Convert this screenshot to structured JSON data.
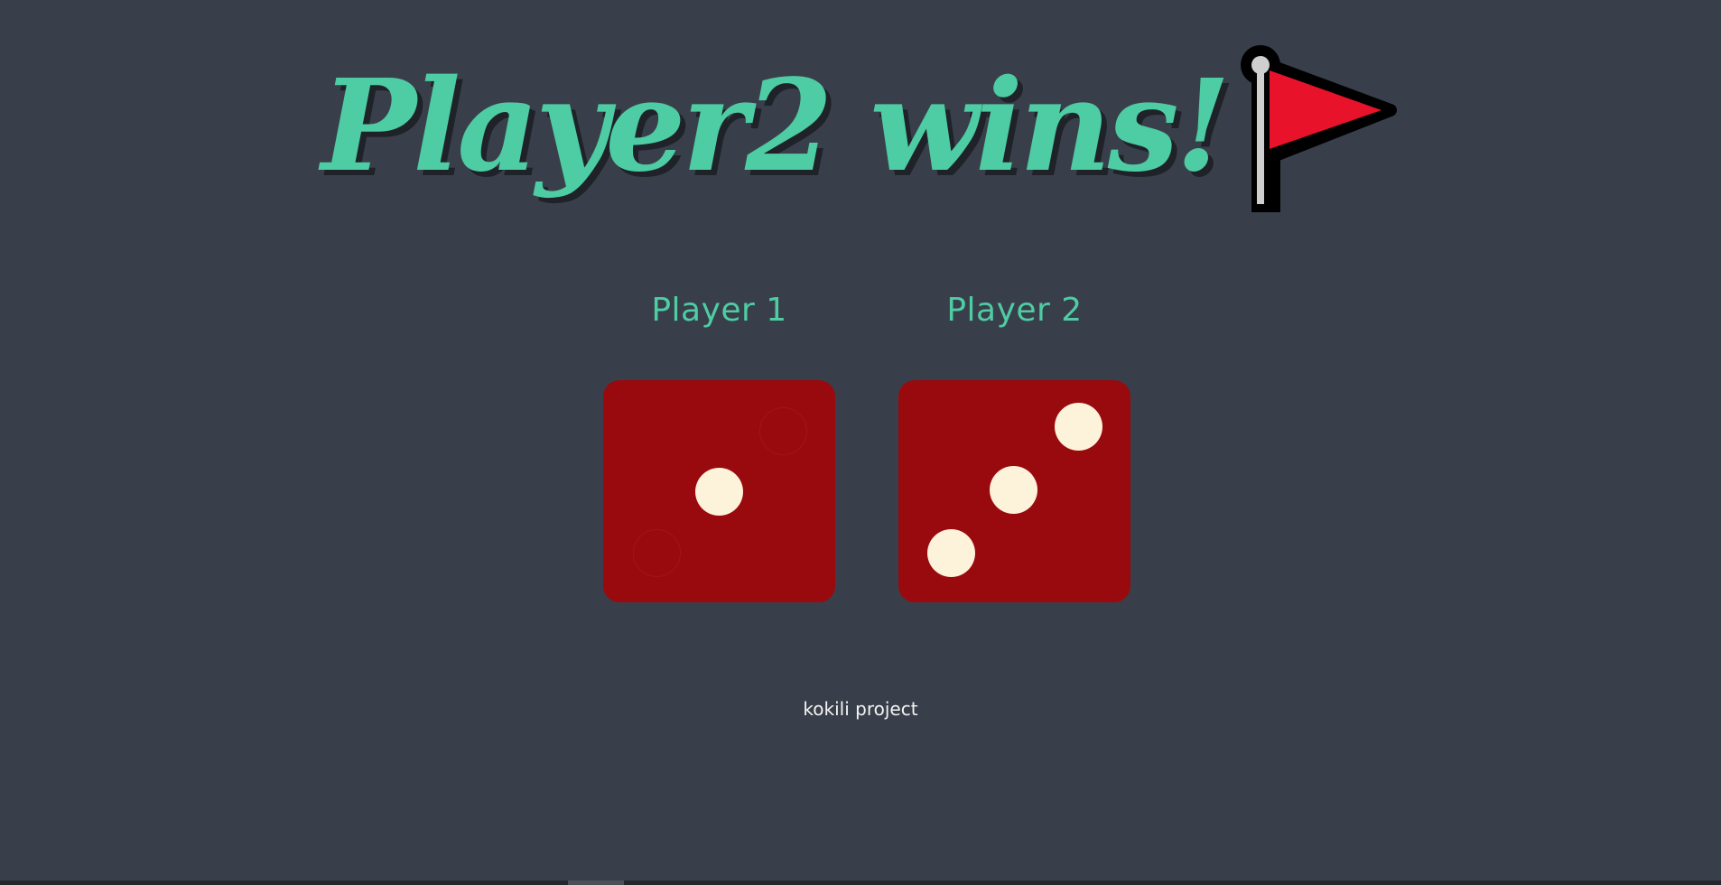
{
  "header": {
    "title": "Player2 wins!",
    "flag_icon": "red-flag-icon"
  },
  "players": [
    {
      "label": "Player 1",
      "die_value": 1
    },
    {
      "label": "Player 2",
      "die_value": 3
    }
  ],
  "footer": {
    "text": "kokili project"
  },
  "colors": {
    "background": "#393f4a",
    "accent": "#4ecca3",
    "die": "#990a0e",
    "pip": "#fdf2da",
    "flag": "#e8132a"
  }
}
